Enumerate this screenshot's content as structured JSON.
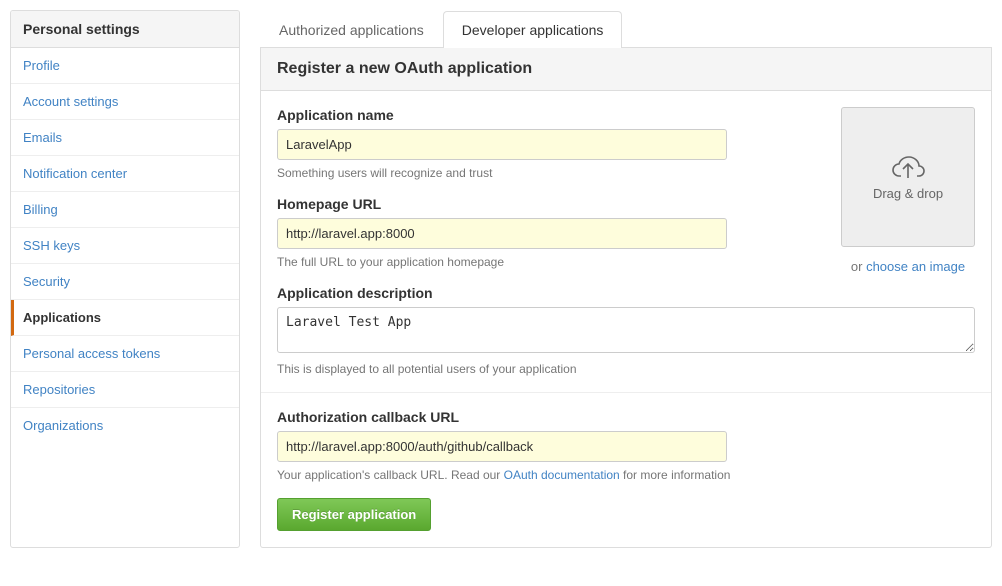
{
  "sidebar": {
    "title": "Personal settings",
    "items": [
      {
        "label": "Profile"
      },
      {
        "label": "Account settings"
      },
      {
        "label": "Emails"
      },
      {
        "label": "Notification center"
      },
      {
        "label": "Billing"
      },
      {
        "label": "SSH keys"
      },
      {
        "label": "Security"
      },
      {
        "label": "Applications"
      },
      {
        "label": "Personal access tokens"
      },
      {
        "label": "Repositories"
      },
      {
        "label": "Organizations"
      }
    ],
    "active_index": 7
  },
  "tabs": {
    "items": [
      {
        "label": "Authorized applications"
      },
      {
        "label": "Developer applications"
      }
    ],
    "active_index": 1
  },
  "panel": {
    "title": "Register a new OAuth application"
  },
  "form": {
    "app_name": {
      "label": "Application name",
      "value": "LaravelApp",
      "help": "Something users will recognize and trust"
    },
    "homepage_url": {
      "label": "Homepage URL",
      "value": "http://laravel.app:8000",
      "help": "The full URL to your application homepage"
    },
    "description": {
      "label": "Application description",
      "value": "Laravel Test App",
      "help": "This is displayed to all potential users of your application"
    },
    "callback_url": {
      "label": "Authorization callback URL",
      "value": "http://laravel.app:8000/auth/github/callback",
      "help_prefix": "Your application's callback URL. Read our ",
      "help_link": "OAuth documentation",
      "help_suffix": " for more information"
    },
    "upload": {
      "drag_drop": "Drag & drop",
      "or": "or ",
      "choose": "choose an image"
    },
    "submit": "Register application"
  }
}
